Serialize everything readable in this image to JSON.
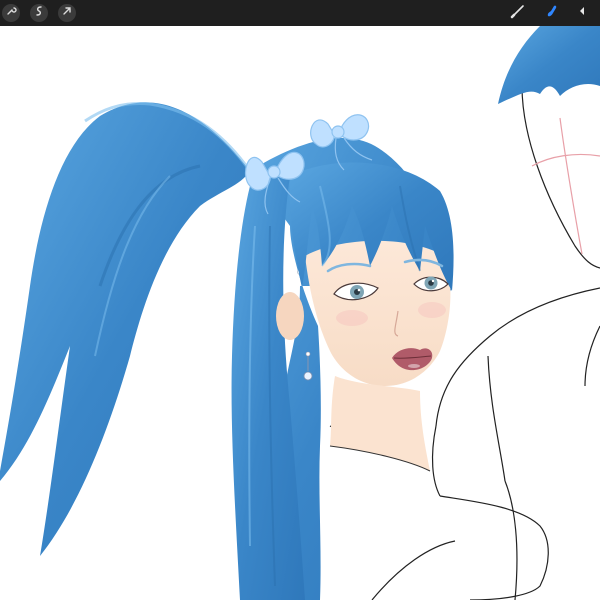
{
  "toolbar": {
    "left_tools": [
      {
        "icon": "wrench-icon"
      },
      {
        "icon": "adjustments-icon"
      },
      {
        "icon": "selection-arrow-icon"
      }
    ],
    "right_tools": [
      {
        "icon": "brush-icon",
        "active": false
      },
      {
        "icon": "smudge-icon",
        "active": true,
        "color": "#2f86ff"
      },
      {
        "icon": "eraser-icon",
        "active": false
      }
    ],
    "background": "#1f1f1f"
  },
  "canvas": {
    "background": "#ffffff",
    "artwork": {
      "hair_color": "#3a86c8",
      "bow_color": "#bfe0ff",
      "skin_color": "#fbe3d0",
      "lip_color": "#b05b69"
    }
  }
}
